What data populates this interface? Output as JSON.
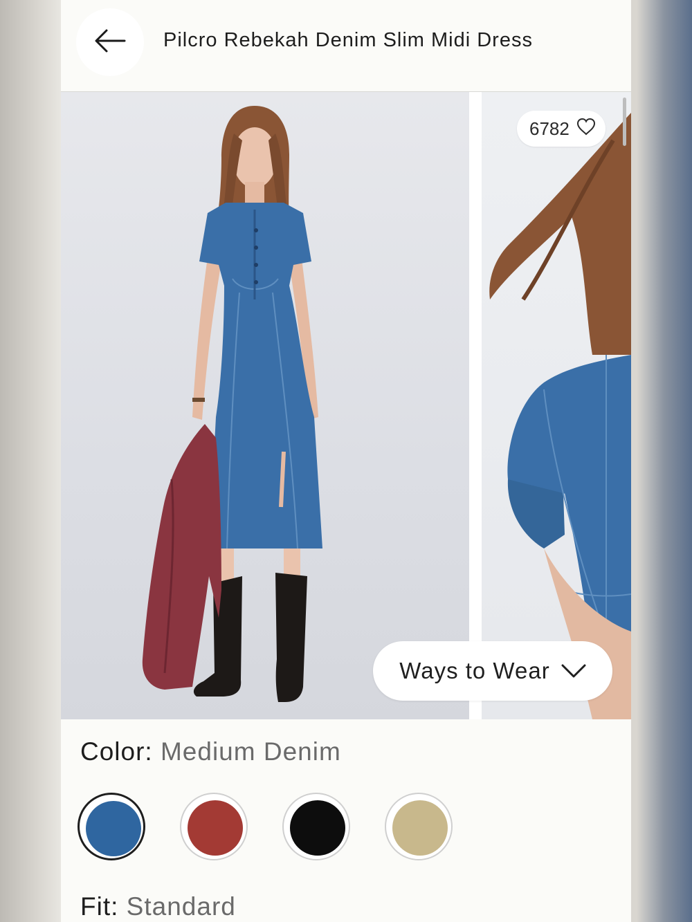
{
  "header": {
    "back_icon": "arrow-left-icon",
    "title": "Pilcro Rebekah Denim Slim Midi Dress"
  },
  "gallery": {
    "likes_count": "6782",
    "likes_icon": "heart-outline-icon",
    "ways_to_wear_label": "Ways to Wear",
    "ways_to_wear_icon": "chevron-down-icon"
  },
  "color": {
    "label": "Color:",
    "value": "Medium Denim",
    "swatches": [
      {
        "name": "Medium Denim",
        "color": "#2f66a0",
        "selected": true
      },
      {
        "name": "Red",
        "color": "#a33a34",
        "selected": false
      },
      {
        "name": "Black",
        "color": "#0d0d0d",
        "selected": false
      },
      {
        "name": "Tan",
        "color": "#c8b88c",
        "selected": false
      }
    ]
  },
  "fit": {
    "label": "Fit:",
    "value": "Standard"
  },
  "colors": {
    "denim": "#3a6fa8",
    "jacket": "#8a3540",
    "boots": "#1d1917",
    "hair": "#8a5535"
  }
}
